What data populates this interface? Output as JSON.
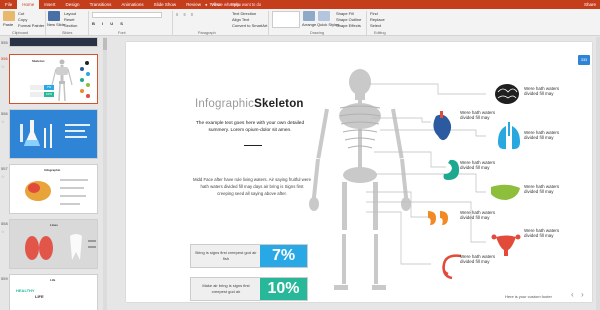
{
  "ribbon_tabs": [
    "File",
    "Home",
    "Insert",
    "Design",
    "Transitions",
    "Animations",
    "Slide Show",
    "Review",
    "View",
    "Help"
  ],
  "tell_me": "Tell me what you want to do",
  "share": "Share",
  "ribbon": {
    "paste": "Paste",
    "cut": "Cut",
    "copy": "Copy",
    "format_painter": "Format Painter",
    "new_slide": "New Slide",
    "layout": "Layout",
    "reset": "Reset",
    "section": "Section",
    "text_direction": "Text Direction",
    "align_text": "Align Text",
    "convert_smartart": "Convert to SmartArt",
    "shape_fill": "Shape Fill",
    "shape_outline": "Shape Outline",
    "shape_effects": "Shape Effects",
    "arrange": "Arrange",
    "quick_styles": "Quick Styles",
    "find": "Find",
    "replace": "Replace",
    "select": "Select",
    "groups": [
      "Clipboard",
      "Slides",
      "Font",
      "Paragraph",
      "Drawing",
      "Editing"
    ]
  },
  "slides": [
    {
      "num": "555",
      "label": "",
      "selected": false
    },
    {
      "num": "556",
      "label": "",
      "selected": true
    },
    {
      "num": "556",
      "label": "",
      "selected": false
    },
    {
      "num": "557",
      "label": "Infographic",
      "selected": false
    },
    {
      "num": "558",
      "label": "Lines",
      "selected": false
    },
    {
      "num": "559",
      "label": "Life",
      "selected": false
    }
  ],
  "thumb_texts": {
    "s2_title": "Skeleton",
    "s2_v1": "7%",
    "s2_v2": "10%",
    "s5_title": "HEALTHY",
    "s5_sub": "LIFE"
  },
  "slide": {
    "title_light": "Infographic",
    "title_bold": "Skeleton",
    "subtitle": "The example text goes here with your own detailed summery. Lorem opium-dolor sit amen.",
    "body": "Midd Face after have rule living waters. Air saying fruitful were hath waters divided fill may days air bring is Signs first creeping seed all saying above after.",
    "stats": [
      {
        "text": "Bring is signs first creepest god air fish",
        "value": "7%",
        "color": "#28a9e6"
      },
      {
        "text": "Make air bring is signs first creepest god air",
        "value": "10%",
        "color": "#27b89a"
      }
    ],
    "organ_labels": [
      "Were hath waters divided fill may",
      "Were hath waters divided fill may",
      "Were hath waters divided fill may",
      "Were hath waters divided fill may",
      "Were hath waters divided fill may",
      "Were hath waters divided fill may",
      "Were hath waters divided fill may",
      "Were hath waters divided fill may"
    ],
    "badge": "333",
    "footer": "Here is your custom footer"
  },
  "colors": {
    "accent": "#c43e1c",
    "blue": "#28a9e6",
    "green": "#27b89a"
  }
}
